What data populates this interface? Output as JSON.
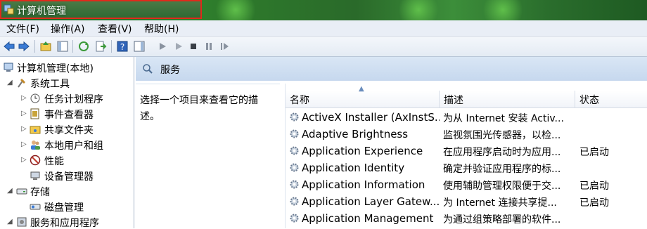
{
  "window": {
    "title": "计算机管理"
  },
  "menu": [
    "文件(F)",
    "操作(A)",
    "查看(V)",
    "帮助(H)"
  ],
  "tree": {
    "root": "计算机管理(本地)",
    "system_tools": "系统工具",
    "items": [
      "任务计划程序",
      "事件查看器",
      "共享文件夹",
      "本地用户和组",
      "性能",
      "设备管理器"
    ],
    "storage": "存储",
    "disk_mgmt": "磁盘管理",
    "services_apps": "服务和应用程序"
  },
  "content": {
    "title": "服务",
    "description": "选择一个项目来查看它的描述。",
    "columns": {
      "name": "名称",
      "desc": "描述",
      "status": "状态"
    },
    "rows": [
      {
        "name": "ActiveX Installer (AxInstS...",
        "desc": "为从 Internet 安装 Activ...",
        "status": ""
      },
      {
        "name": "Adaptive Brightness",
        "desc": "监视氛围光传感器，以检...",
        "status": ""
      },
      {
        "name": "Application Experience",
        "desc": "在应用程序启动时为应用...",
        "status": "已启动"
      },
      {
        "name": "Application Identity",
        "desc": "确定并验证应用程序的标...",
        "status": ""
      },
      {
        "name": "Application Information",
        "desc": "使用辅助管理权限便于交...",
        "status": "已启动"
      },
      {
        "name": "Application Layer Gatew...",
        "desc": "为 Internet 连接共享提...",
        "status": "已启动"
      },
      {
        "name": "Application Management",
        "desc": "为通过组策略部署的软件...",
        "status": ""
      }
    ]
  },
  "colors": {
    "highlight": "#e0291b",
    "header_bg": "#c6d8ee",
    "menu_bg": "#e9eef6"
  }
}
